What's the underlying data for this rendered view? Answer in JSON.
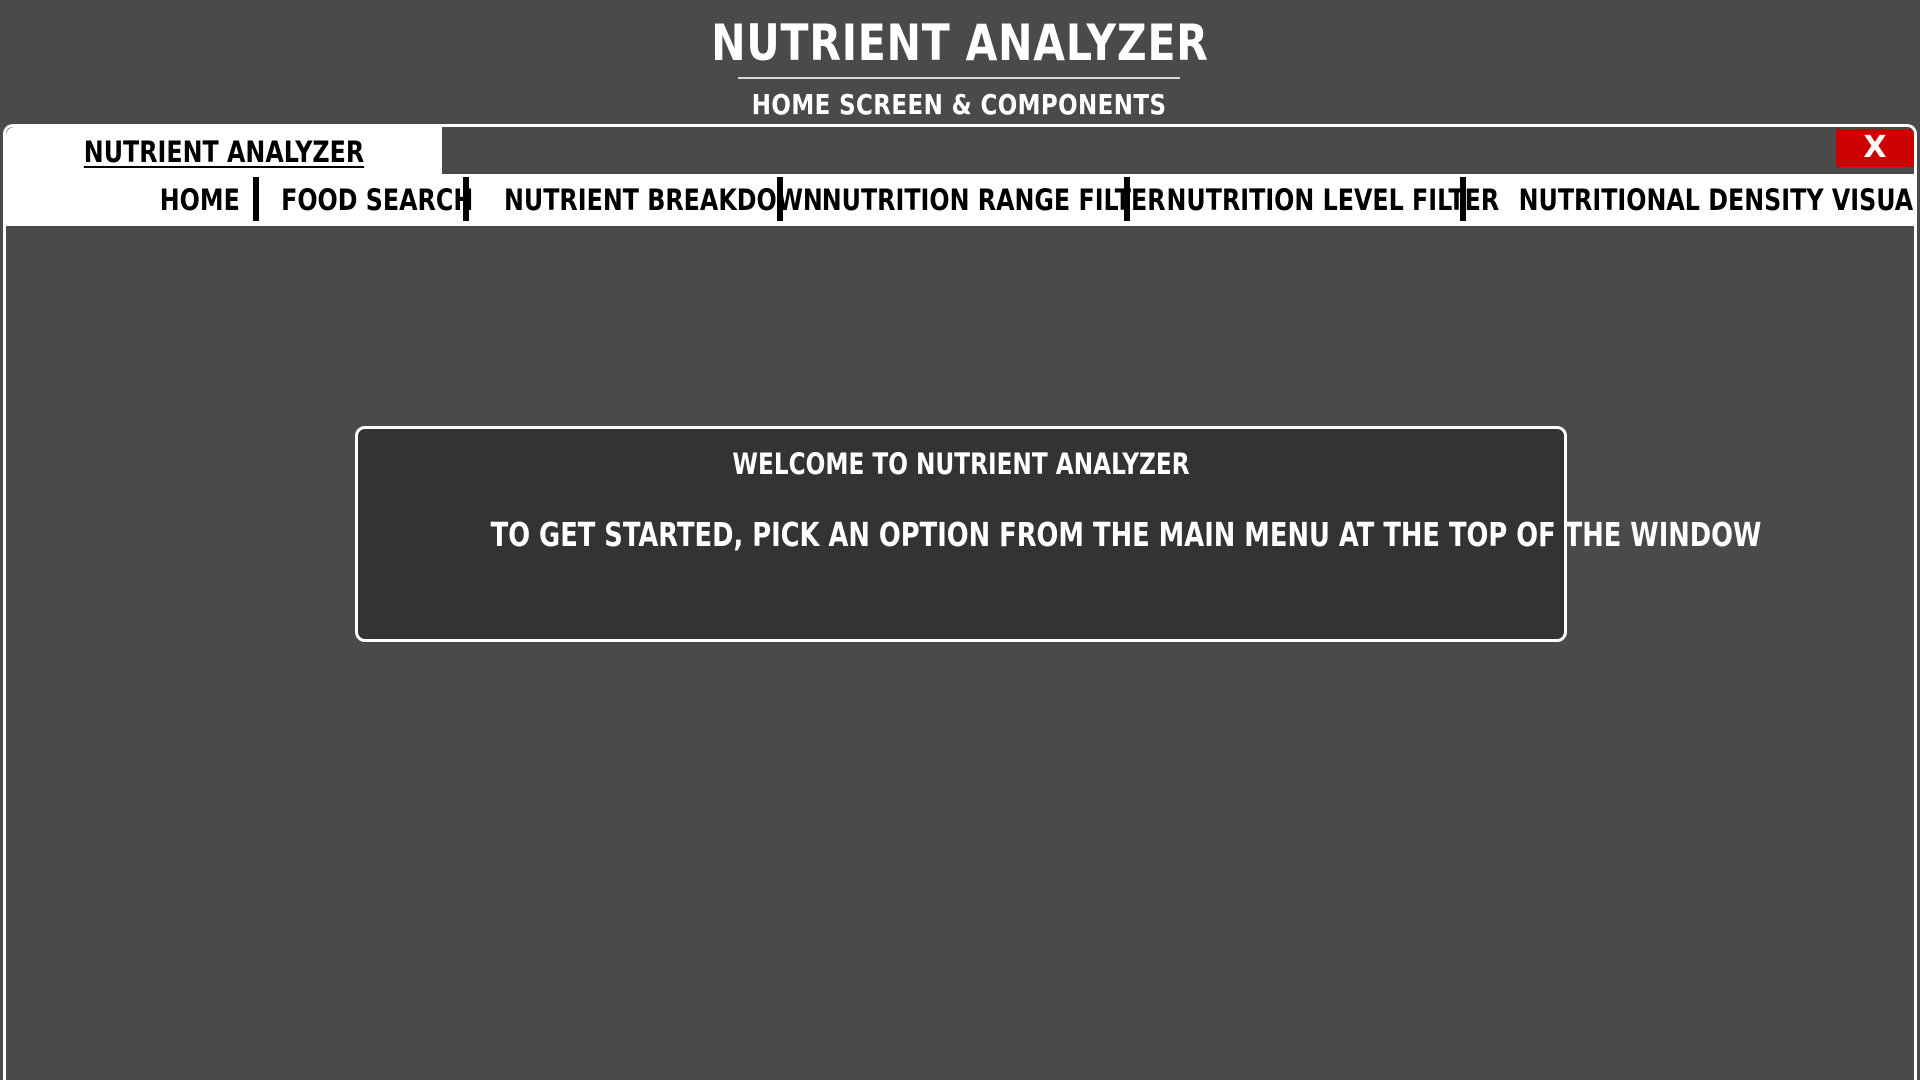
{
  "header": {
    "title": "NUTRIENT ANALYZER",
    "subtitle": "HOME SCREEN & COMPONENTS"
  },
  "window": {
    "app_tab_label": "NUTRIENT ANALYZER",
    "close_label": "X"
  },
  "menu": {
    "items": [
      {
        "label": "HOME"
      },
      {
        "label": "FOOD SEARCH"
      },
      {
        "label": "NUTRIENT BREAKDOWN"
      },
      {
        "label": "NUTRITION RANGE FILTER"
      },
      {
        "label": "NUTRITION LEVEL FILTER"
      },
      {
        "label": "NUTRITIONAL DENSITY VISUALIZER"
      }
    ]
  },
  "welcome": {
    "title": "WELCOME TO NUTRIENT ANALYZER",
    "message": "TO GET STARTED, PICK AN OPTION FROM THE MAIN MENU AT THE TOP OF THE WINDOW"
  },
  "colors": {
    "background": "#4a4a4a",
    "panel": "#333333",
    "close_button": "#cc0000",
    "menu_bar": "#ffffff"
  }
}
